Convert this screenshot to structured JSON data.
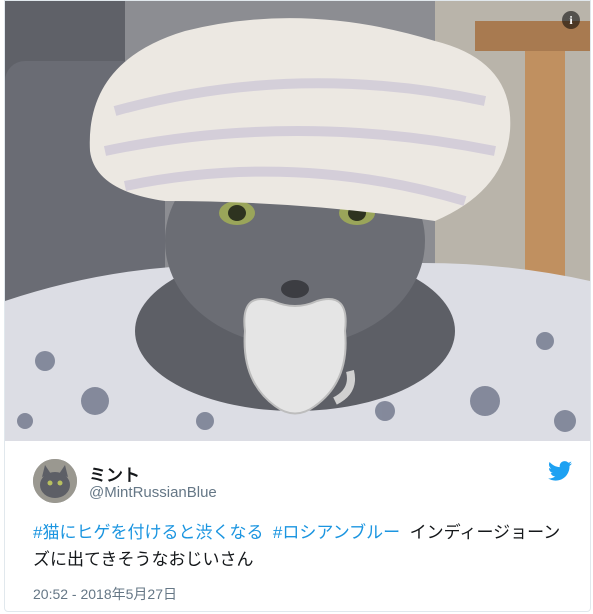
{
  "tweet": {
    "author_name": "ミント",
    "author_handle": "@MintRussianBlue",
    "hashtag_1": "#猫にヒゲを付けると渋くなる",
    "hashtag_2": "#ロシアンブルー",
    "body_text": "インディージョーンズに出てきそうなおじいさん",
    "timestamp": "20:52 - 2018年5月27日"
  },
  "icons": {
    "info": "info-icon",
    "twitter": "twitter-bird-icon",
    "info_glyph": "i"
  },
  "colors": {
    "link": "#1b95e0",
    "text": "#14171a",
    "meta": "#657786",
    "twitter_blue": "#1da1f2"
  }
}
